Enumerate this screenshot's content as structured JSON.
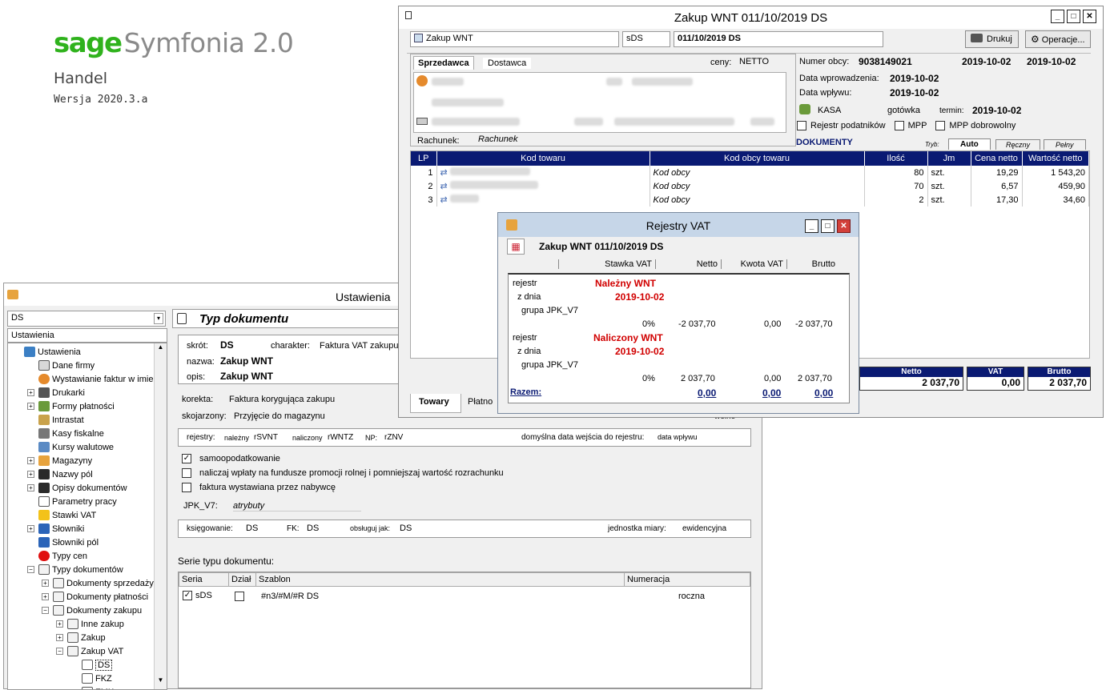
{
  "brand": {
    "sage": "sage",
    "product": "Symfonia 2.0",
    "module": "Handel",
    "version": "Wersja 2020.3.a"
  },
  "ust": {
    "title": "Ustawienia",
    "combo": "DS",
    "tree_header": "Ustawienia",
    "panel_title": "Typ dokumentu",
    "tree": [
      {
        "label": "Ustawienia",
        "icon": "tools-icon",
        "indent": 0,
        "exp": ""
      },
      {
        "label": "Dane firmy",
        "icon": "card-icon",
        "indent": 1,
        "exp": ""
      },
      {
        "label": "Wystawianie faktur w imieniu",
        "icon": "person-icon",
        "indent": 1,
        "exp": ""
      },
      {
        "label": "Drukarki",
        "icon": "printer-icon",
        "indent": 1,
        "exp": "+"
      },
      {
        "label": "Formy płatności",
        "icon": "money-icon",
        "indent": 1,
        "exp": "+"
      },
      {
        "label": "Intrastat",
        "icon": "pencil-icon",
        "indent": 1,
        "exp": ""
      },
      {
        "label": "Kasy fiskalne",
        "icon": "register-icon",
        "indent": 1,
        "exp": ""
      },
      {
        "label": "Kursy walutowe",
        "icon": "chart-icon",
        "indent": 1,
        "exp": ""
      },
      {
        "label": "Magazyny",
        "icon": "warehouse-icon",
        "indent": 1,
        "exp": "+"
      },
      {
        "label": "Nazwy pól",
        "icon": "az-icon",
        "indent": 1,
        "exp": "+"
      },
      {
        "label": "Opisy dokumentów",
        "icon": "az-icon",
        "indent": 1,
        "exp": "+"
      },
      {
        "label": "Parametry pracy",
        "icon": "doc-icon",
        "indent": 1,
        "exp": ""
      },
      {
        "label": "Stawki VAT",
        "icon": "vat-icon",
        "indent": 1,
        "exp": ""
      },
      {
        "label": "Słowniki",
        "icon": "dict-icon",
        "indent": 1,
        "exp": "+"
      },
      {
        "label": "Słowniki pól",
        "icon": "dict-icon",
        "indent": 1,
        "exp": ""
      },
      {
        "label": "Typy cen",
        "icon": "reddot-icon",
        "indent": 1,
        "exp": ""
      },
      {
        "label": "Typy dokumentów",
        "icon": "folder-icon",
        "indent": 1,
        "exp": "-"
      },
      {
        "label": "Dokumenty sprzedaży",
        "icon": "folder-icon",
        "indent": 2,
        "exp": "+"
      },
      {
        "label": "Dokumenty płatności",
        "icon": "folder-icon",
        "indent": 2,
        "exp": "+"
      },
      {
        "label": "Dokumenty zakupu",
        "icon": "folder-icon",
        "indent": 2,
        "exp": "-"
      },
      {
        "label": "Inne zakup",
        "icon": "folder-icon",
        "indent": 3,
        "exp": "+"
      },
      {
        "label": "Zakup",
        "icon": "folder-icon",
        "indent": 3,
        "exp": "+"
      },
      {
        "label": "Zakup VAT",
        "icon": "folder-icon",
        "indent": 3,
        "exp": "-"
      },
      {
        "label": "DS",
        "icon": "doc-icon",
        "indent": 4,
        "exp": ""
      },
      {
        "label": "FKZ",
        "icon": "doc-icon",
        "indent": 4,
        "exp": ""
      },
      {
        "label": "FMK",
        "icon": "doc-icon",
        "indent": 4,
        "exp": ""
      }
    ],
    "skrot_label": "skrót:",
    "skrot": "DS",
    "charakter_label": "charakter:",
    "charakter": "Faktura VAT zakupu",
    "nazwa_label": "nazwa:",
    "nazwa": "Zakup WNT",
    "opis_label": "opis:",
    "opis": "Zakup WNT",
    "korekta_label": "korekta:",
    "korekta": "Faktura korygująca zakupu",
    "skojarzony_label": "skojarzony:",
    "skojarzony": "Przyjęcie do magazynu",
    "wolne": "wolne",
    "rejestry_label": "rejestry:",
    "nalezny_label": "należny",
    "nalezny": "rSVNT",
    "naliczony_label": "naliczony",
    "naliczony": "rWNTZ",
    "np_label": "NP:",
    "np": "rZNV",
    "data_label": "domyślna data wejścia do rejestru:",
    "data": "data wpływu",
    "chk1": "samoopodatkowanie",
    "chk2": "naliczaj wpłaty na fundusze promocji rolnej i pomniejszaj wartość rozrachunku",
    "chk3": "faktura wystawiana przez nabywcę",
    "jpk_label": "JPK_V7:",
    "jpk": "atrybuty",
    "ksieg_label": "księgowanie:",
    "ksieg": "DS",
    "fk_label": "FK:",
    "fk": "DS",
    "obsl_label": "obsługuj jak:",
    "obsl": "DS",
    "jm_label": "jednostka miary:",
    "jm": "ewidencyjna",
    "serie_title": "Serie typu dokumentu:",
    "serie_headers": [
      "Seria",
      "Dział",
      "Szablon",
      "Numeracja"
    ],
    "serie_row": {
      "seria": "sDS",
      "szablon": "#n3/#M/#R DS",
      "numeracja": "roczna"
    }
  },
  "zak": {
    "title": "Zakup WNT 011/10/2019 DS",
    "type": "Zakup WNT",
    "series": "sDS",
    "number": "011/10/2019 DS",
    "drukuj": "Drukuj",
    "operacje": "Operacje...",
    "tab_sprz": "Sprzedawca",
    "tab_dost": "Dostawca",
    "ceny_label": "ceny:",
    "ceny": "NETTO",
    "rachunek_label": "Rachunek:",
    "rachunek": "Rachunek",
    "numer_obcy_label": "Numer obcy:",
    "numer_obcy": "9038149021",
    "date1": "2019-10-02",
    "date2": "2019-10-02",
    "wpr_label": "Data wprowadzenia:",
    "wpr": "2019-10-02",
    "wpl_label": "Data wpływu:",
    "wpl": "2019-10-02",
    "kasa": "KASA",
    "gotowka": "gotówka",
    "termin_label": "termin:",
    "termin": "2019-10-02",
    "rejestr_pod": "Rejestr podatników",
    "mpp": "MPP",
    "mpp_dobr": "MPP dobrowolny",
    "dokumenty": "DOKUMENTY",
    "tryb": "Tryb:",
    "tabs": [
      "Auto",
      "Ręczny",
      "Pełny"
    ],
    "headers": [
      "LP",
      "Kod towaru",
      "Kod obcy towaru",
      "Ilość",
      "Jm",
      "Cena netto",
      "Wartość netto"
    ],
    "rows": [
      {
        "lp": "1",
        "kod_obcy": "Kod obcy",
        "ilosc": "80",
        "jm": "szt.",
        "cena": "19,29",
        "wartosc": "1 543,20"
      },
      {
        "lp": "2",
        "kod_obcy": "Kod obcy",
        "ilosc": "70",
        "jm": "szt.",
        "cena": "6,57",
        "wartosc": "459,90"
      },
      {
        "lp": "3",
        "kod_obcy": "Kod obcy",
        "ilosc": "2",
        "jm": "szt.",
        "cena": "17,30",
        "wartosc": "34,60"
      }
    ],
    "sum_netto_label": "Netto",
    "sum_netto": "2 037,70",
    "sum_vat_label": "VAT",
    "sum_vat": "0,00",
    "sum_brutto_label": "Brutto",
    "sum_brutto": "2 037,70",
    "bottom_tab1": "Towary",
    "bottom_tab2": "Płatno"
  },
  "rej": {
    "title": "Rejestry VAT",
    "header": "Zakup WNT 011/10/2019 DS",
    "cols": [
      "Stawka VAT",
      "Netto",
      "Kwota VAT",
      "Brutto"
    ],
    "rejestr_label": "rejestr",
    "zdnia_label": "z dnia",
    "grupa_label": "grupa JPK_V7",
    "r1": {
      "name": "Należny WNT",
      "date": "2019-10-02",
      "stawka": "0%",
      "netto": "-2 037,70",
      "vat": "0,00",
      "brutto": "-2 037,70"
    },
    "r2": {
      "name": "Naliczony WNT",
      "date": "2019-10-02",
      "stawka": "0%",
      "netto": "2 037,70",
      "vat": "0,00",
      "brutto": "2 037,70"
    },
    "razem_label": "Razem:",
    "razem_netto": "0,00",
    "razem_vat": "0,00",
    "razem_brutto": "0,00"
  }
}
